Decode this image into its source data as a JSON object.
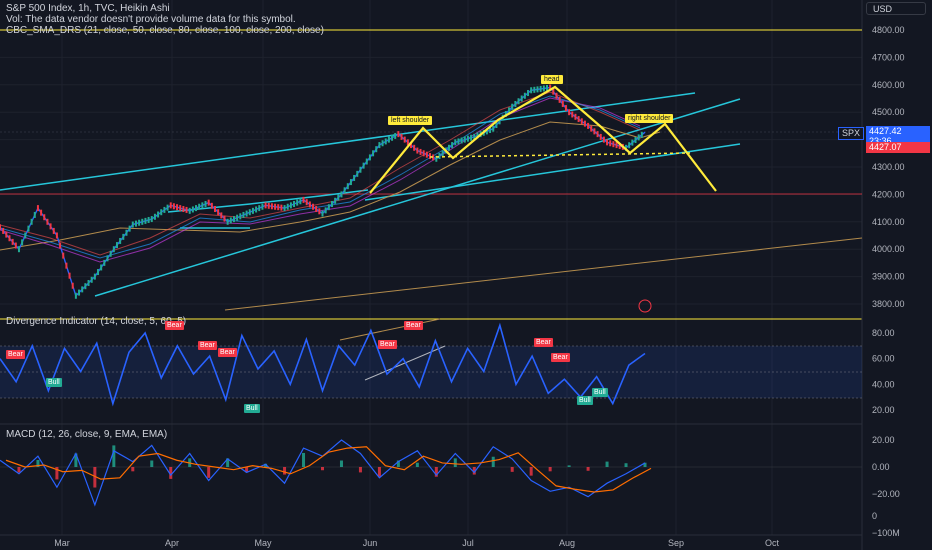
{
  "header": {
    "title": "S&P 500 Index, 1h, TVC, Heikin Ashi",
    "vol_notice": "Vol: The data vendor doesn't provide volume data for this symbol.",
    "sma_indicator": "CBC_SMA_DRS (21, close, 50, close, 80, close, 100, close, 200, close)"
  },
  "currency_button": "USD",
  "price_axis": {
    "ticks": [
      "4800.00",
      "4700.00",
      "4600.00",
      "4500.00",
      "4400.00",
      "4300.00",
      "4200.00",
      "4100.00",
      "4000.00",
      "3900.00",
      "3800.00"
    ],
    "symbol_tag": "SPX",
    "last_price": "4427.42",
    "countdown": "23:36",
    "sma_value": "4427.07"
  },
  "osc_axis": {
    "ticks": [
      "80.00",
      "60.00",
      "40.00",
      "20.00"
    ]
  },
  "macd_axis": {
    "ticks": [
      "20.00",
      "0.00",
      "−20.00",
      "0",
      "−100M"
    ]
  },
  "time_axis": [
    "Mar",
    "Apr",
    "May",
    "Jun",
    "Jul",
    "Aug",
    "Sep",
    "Oct"
  ],
  "divergence_title": "Divergence Indicator (14, close, 5, 60, 5)",
  "macd_title": "MACD (12, 26, close, 9, EMA, EMA)",
  "annotations": {
    "left_shoulder": "left shoulder",
    "head": "head",
    "right_shoulder": "right shoulder"
  },
  "divergence_labels": {
    "bear": "Bear",
    "bull": "Bull"
  },
  "colors": {
    "background": "#131722",
    "price_line": "#2962ff",
    "sma_label": "#f23645",
    "accent_yellow": "#ffeb3b",
    "trend_cyan": "#26c6da",
    "bull": "#22ab94",
    "bear": "#f23645",
    "osc_line": "#2962ff"
  },
  "chart_data": {
    "type": "line",
    "title": "S&P 500 Index, 1h, TVC, Heikin Ashi",
    "x": [
      "Mar",
      "Apr",
      "May",
      "Jun",
      "Jul",
      "Aug",
      "Sep",
      "Oct"
    ],
    "ylim": [
      3770,
      4850
    ],
    "series": [
      {
        "name": "S&P 500 Index",
        "values": [
          4080,
          4000,
          4150,
          4050,
          3830,
          3900,
          4000,
          4090,
          4110,
          4160,
          4140,
          4170,
          4100,
          4130,
          4160,
          4150,
          4180,
          4130,
          4200,
          4290,
          4380,
          4420,
          4360,
          4330,
          4390,
          4410,
          4440,
          4520,
          4580,
          4590,
          4500,
          4450,
          4390,
          4370,
          4427
        ]
      }
    ],
    "oscillator": {
      "name": "Divergence Indicator (14, close, 5, 60, 5)",
      "ylim": [
        15,
        90
      ],
      "values": [
        60,
        42,
        70,
        35,
        68,
        50,
        72,
        25,
        65,
        80,
        45,
        70,
        48,
        62,
        28,
        78,
        52,
        66,
        40,
        75,
        35,
        70,
        55,
        82,
        48,
        60,
        38,
        74,
        42,
        68,
        50,
        86,
        40,
        62,
        33,
        44,
        30,
        46,
        25,
        55,
        64
      ]
    },
    "macd": {
      "name": "MACD (12, 26, close, 9, EMA, EMA)",
      "ylim": [
        -35,
        25
      ],
      "values": [
        5,
        -5,
        8,
        -15,
        10,
        -28,
        12,
        4,
        16,
        -6,
        10,
        -10,
        6,
        -4,
        2,
        -12,
        14,
        8,
        20,
        10,
        -8,
        4,
        12,
        -6,
        10,
        -4,
        15,
        6,
        -10,
        -18,
        -15,
        -22,
        -12,
        -5,
        3
      ]
    }
  }
}
